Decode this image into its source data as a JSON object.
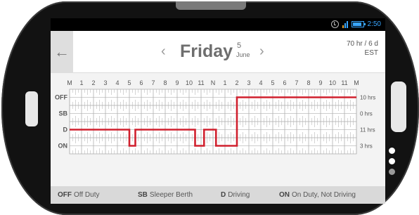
{
  "status_bar": {
    "time": "2:50",
    "alarm_icon": "alarm-icon",
    "signal_icon": "signal-icon",
    "battery_icon": "battery-icon"
  },
  "header": {
    "back_icon": "←",
    "prev_icon": "‹",
    "next_icon": "›",
    "day": "Friday",
    "date_number": "5",
    "month": "June",
    "hours_rule": "70 hr / 6 d",
    "timezone": "EST"
  },
  "chart_data": {
    "type": "line",
    "x_tick_labels": [
      "M",
      "1",
      "2",
      "3",
      "4",
      "5",
      "6",
      "7",
      "8",
      "9",
      "10",
      "11",
      "N",
      "1",
      "2",
      "3",
      "4",
      "5",
      "6",
      "7",
      "8",
      "9",
      "10",
      "11",
      "M"
    ],
    "rows": [
      "OFF",
      "SB",
      "D",
      "ON"
    ],
    "row_totals": [
      "10 hrs",
      "0 hrs",
      "11 hrs",
      "3 hrs"
    ],
    "segments": [
      {
        "status": "D",
        "start": 0,
        "end": 5
      },
      {
        "status": "ON",
        "start": 5,
        "end": 5.5
      },
      {
        "status": "D",
        "start": 5.5,
        "end": 10.5
      },
      {
        "status": "ON",
        "start": 10.5,
        "end": 11.25
      },
      {
        "status": "D",
        "start": 11.25,
        "end": 12.25
      },
      {
        "status": "ON",
        "start": 12.25,
        "end": 14
      },
      {
        "status": "OFF",
        "start": 14,
        "end": 24
      }
    ],
    "line_color": "#d0202e",
    "grid": true
  },
  "legend": [
    {
      "code": "OFF",
      "label": "Off Duty"
    },
    {
      "code": "SB",
      "label": "Sleeper Berth"
    },
    {
      "code": "D",
      "label": "Driving"
    },
    {
      "code": "ON",
      "label": "On Duty, Not Driving"
    }
  ]
}
